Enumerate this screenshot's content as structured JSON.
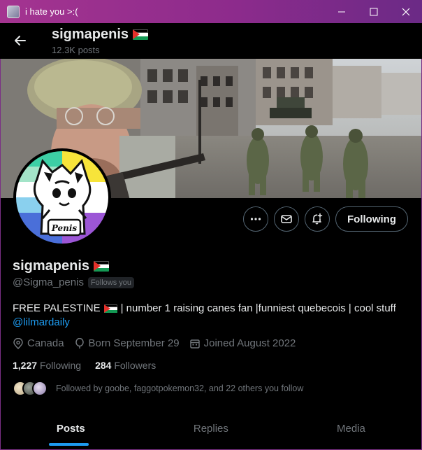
{
  "window": {
    "title": "i hate you >:(",
    "controls": [
      "minimize",
      "maximize",
      "close"
    ]
  },
  "header": {
    "name": "sigmapenis",
    "post_count": "12.3K posts",
    "back_icon": "arrow-left-icon"
  },
  "banner": {
    "description": "photo edit: man in fur hat over street with soldiers"
  },
  "avatar": {
    "caption": "Penis"
  },
  "actions": {
    "more_icon": "more-icon",
    "message_icon": "envelope-icon",
    "notify_icon": "bell-plus-icon",
    "follow_label": "Following"
  },
  "profile": {
    "name": "sigmapenis",
    "handle": "@Sigma_penis",
    "follows_you": "Follows you",
    "bio_prefix": "FREE PALESTINE",
    "bio_rest": "| number 1 raising canes fan |funniest quebecois | cool stuff",
    "bio_link": "@lilmardaily",
    "location": "Canada",
    "born": "Born September 29",
    "joined": "Joined August 2022",
    "following_count": "1,227",
    "following_label": "Following",
    "followers_count": "284",
    "followers_label": "Followers",
    "followed_by": "Followed by goobe, faggotpokemon32, and 22 others you follow"
  },
  "tabs": [
    {
      "label": "Posts",
      "active": true
    },
    {
      "label": "Replies",
      "active": false
    },
    {
      "label": "Media",
      "active": false
    }
  ],
  "colors": {
    "accent": "#1d9bf0",
    "titlebar_start": "#a43490",
    "titlebar_end": "#6b2a86",
    "muted": "#71767b"
  }
}
